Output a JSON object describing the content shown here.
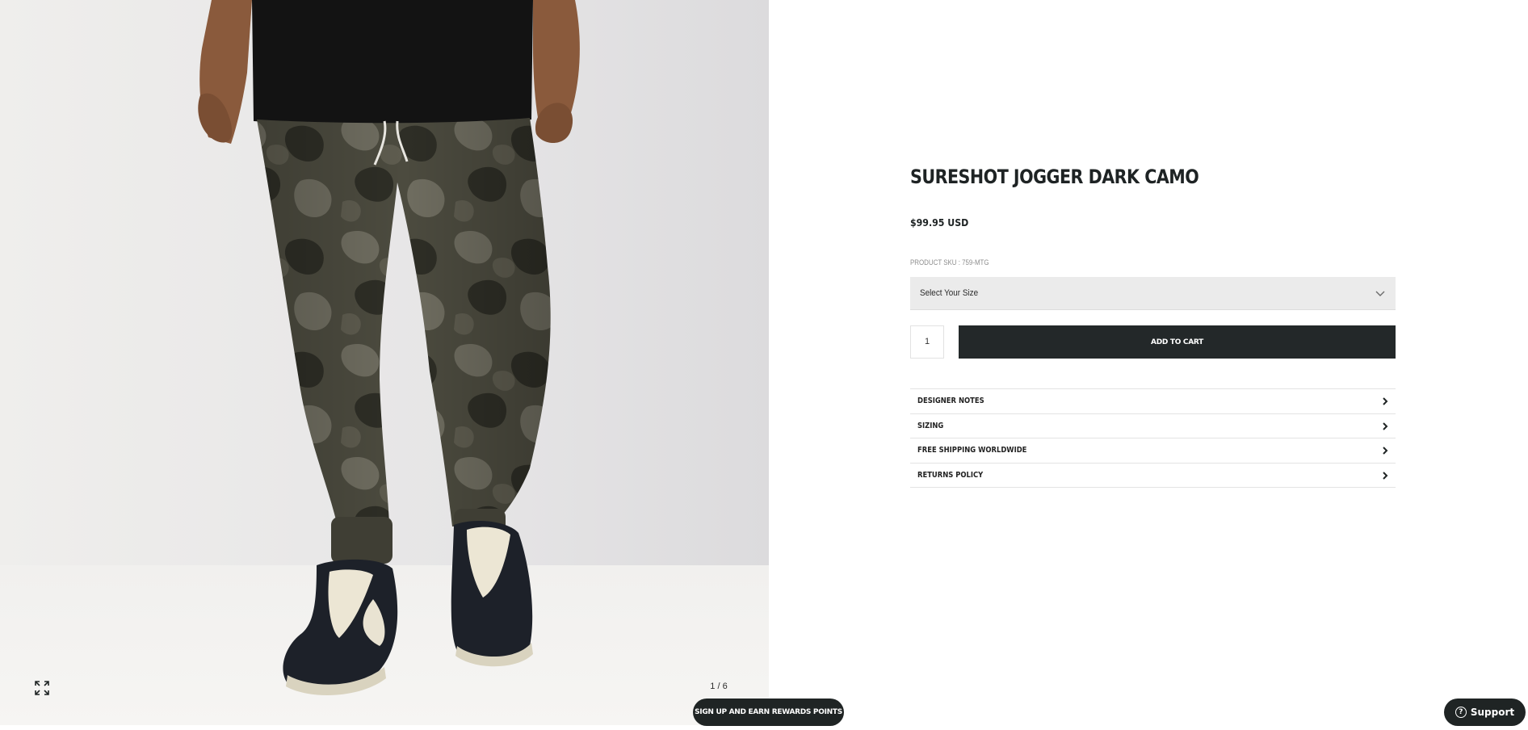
{
  "gallery": {
    "image_alt": "Model wearing dark camo jogger pants with black Nike sneakers",
    "counter": "1 / 6",
    "expand_icon": "expand-icon"
  },
  "product": {
    "title": "SURESHOT JOGGER DARK CAMO",
    "price": "$99.95 USD",
    "sku": "PRODUCT SKU : 759-MTG",
    "size_placeholder": "Select Your Size",
    "quantity": "1",
    "add_to_cart": "ADD TO CART"
  },
  "accordion": [
    {
      "label": "DESIGNER NOTES"
    },
    {
      "label": "SIZING"
    },
    {
      "label": "FREE SHIPPING WORLDWIDE"
    },
    {
      "label": "RETURNS POLICY"
    }
  ],
  "rewards": {
    "label": "SIGN UP AND EARN REWARDS POINTS"
  },
  "support": {
    "label": "Support",
    "icon": "question-icon"
  },
  "colors": {
    "dark": "#1f2424",
    "select_bg": "#ebebeb",
    "divider": "#e3e3e3"
  }
}
